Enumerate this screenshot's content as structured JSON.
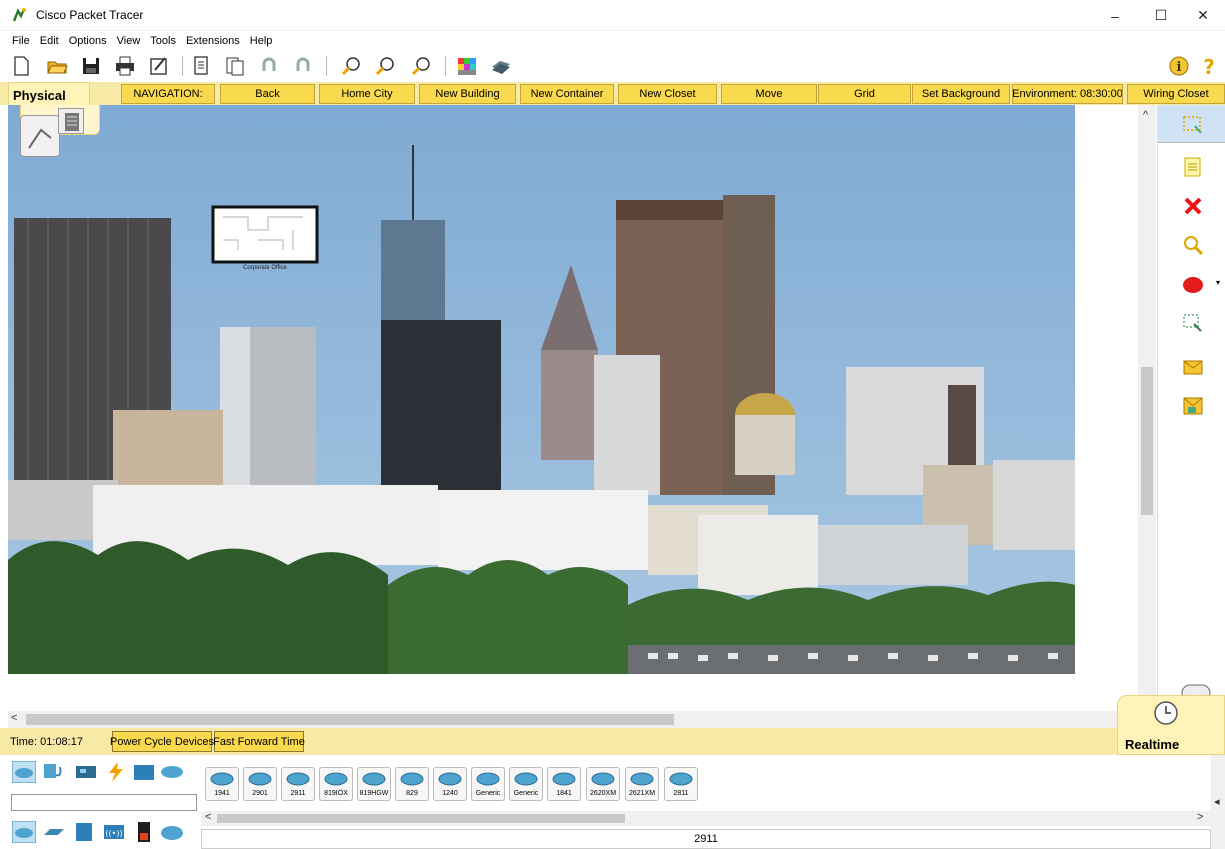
{
  "window": {
    "title": "Cisco Packet Tracer",
    "minimize": "–",
    "maximize": "☐",
    "close": "✕"
  },
  "menu": [
    "File",
    "Edit",
    "Options",
    "View",
    "Tools",
    "Extensions",
    "Help"
  ],
  "toolbar": {
    "icons": [
      "new-icon",
      "open-icon",
      "save-icon",
      "print-icon",
      "activity-wizard-icon",
      "copy-icon",
      "paste-icon",
      "undo-icon",
      "redo-icon",
      "zoom-in-icon",
      "zoom-reset-icon",
      "zoom-out-icon",
      "palette-icon",
      "custom-device-icon"
    ],
    "info": "i",
    "help": "?"
  },
  "navigation": {
    "physical_tab": "Physical",
    "label": "NAVIGATION:",
    "buttons": [
      "Back",
      "Home City",
      "New Building",
      "New Container",
      "New Closet",
      "Move",
      "Grid",
      "Set Background",
      "Environment: 08:30:00",
      "Wiring Closet"
    ]
  },
  "workspace": {
    "building_label": "Corporate Office"
  },
  "palette": {
    "icons": [
      "select-icon",
      "note-icon",
      "delete-icon",
      "inspect-icon",
      "draw-ellipse-icon",
      "resize-icon",
      "add-simple-pdu-icon",
      "add-complex-pdu-icon"
    ]
  },
  "timebar": {
    "time": "Time: 01:08:17",
    "power_cycle": "Power Cycle Devices",
    "fast_forward": "Fast Forward Time",
    "mode": "Realtime"
  },
  "devices": {
    "categories": [
      "network-devices-icon",
      "end-devices-icon",
      "components-icon",
      "connections-icon",
      "miscellaneous-icon",
      "multiuser-icon"
    ],
    "subcategories": [
      "routers-icon",
      "switches-icon",
      "hubs-icon",
      "wireless-icon",
      "security-icon",
      "wan-emulation-icon"
    ],
    "search_value": "",
    "models": [
      "1941",
      "2901",
      "2911",
      "819IOX",
      "819HGW",
      "829",
      "1240",
      "Generic",
      "Generic",
      "1841",
      "2620XM",
      "2621XM",
      "2811"
    ],
    "selected": "2911"
  },
  "colors": {
    "nav_bar": "#f7e9a6",
    "nav_button": "#f9d94e",
    "sky": "#8fb5d8",
    "trees": "#2f5a2a"
  }
}
